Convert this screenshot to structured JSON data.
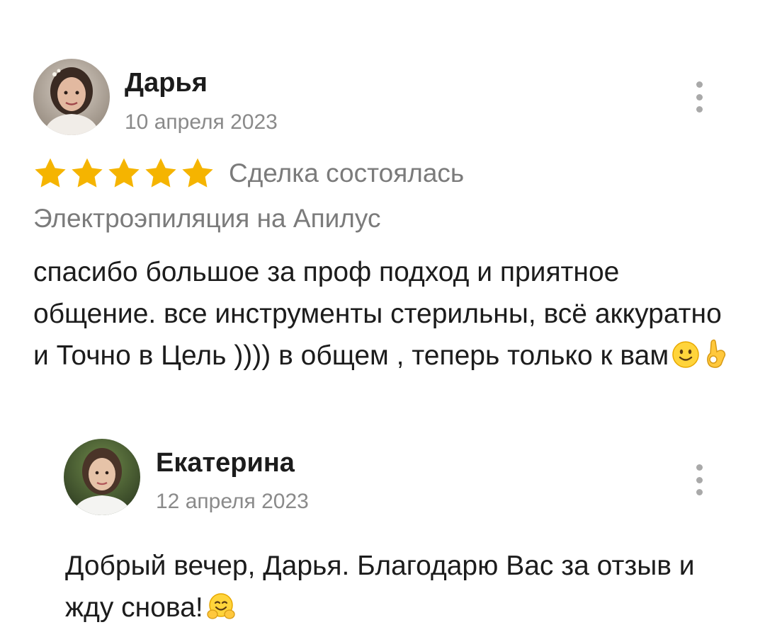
{
  "review": {
    "author": {
      "name": "Дарья",
      "avatar_icon": "avatar-photo-woman-icon"
    },
    "date": "10 апреля 2023",
    "rating": 5,
    "rating_max": 5,
    "deal_status": "Сделка состоялась",
    "service": "Электроэпиляция на Апилус",
    "text": "спасибо большое за проф подход и приятное общение. все инструменты стерильны, всё аккуратно и Точно в Цель )))) в общем , теперь только к вам",
    "text_emojis": [
      "slightly-smiling-face-emoji",
      "ok-hand-emoji"
    ],
    "more_icon": "more-vertical-icon"
  },
  "reply": {
    "author": {
      "name": "Екатерина",
      "avatar_icon": "avatar-photo-woman-icon"
    },
    "date": "12 апреля 2023",
    "text": "Добрый вечер, Дарья. Благодарю Вас за отзыв и жду снова!",
    "text_emojis": [
      "hugging-face-emoji"
    ],
    "more_icon": "more-vertical-icon"
  },
  "colors": {
    "star": "#F5B400",
    "muted_text": "#7B7B7B",
    "date_text": "#8A8A8A",
    "primary_text": "#1C1C1C",
    "more_dots": "#A9A9A9"
  }
}
